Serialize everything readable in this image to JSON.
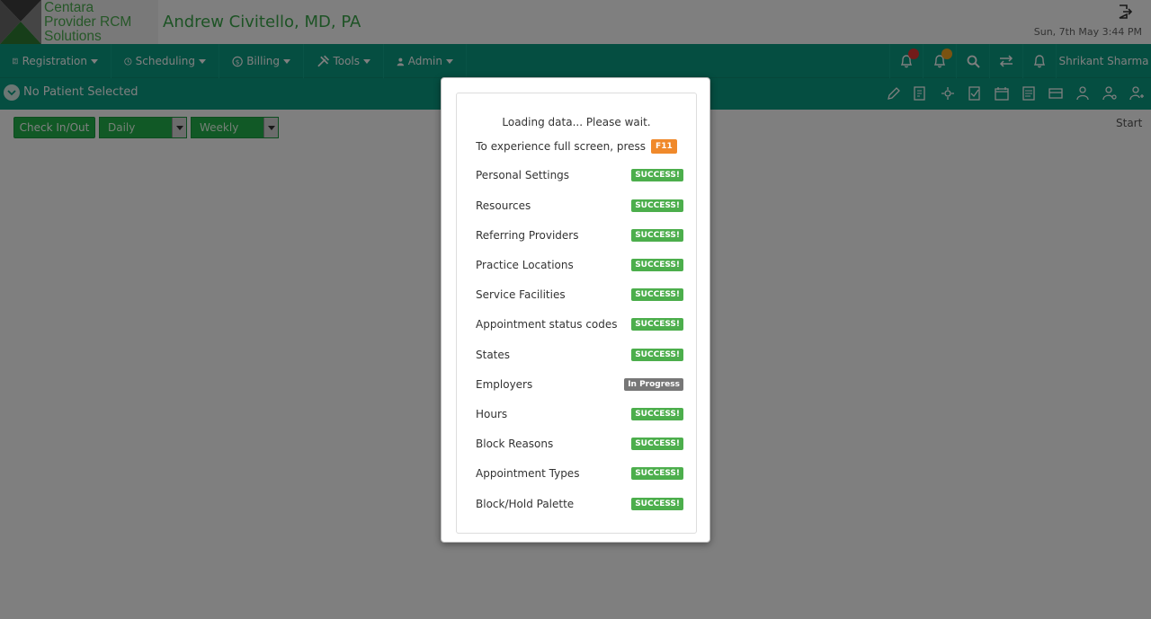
{
  "header": {
    "logo_lines": [
      "Centara",
      "Provider RCM",
      "Solutions"
    ],
    "provider_name": "Andrew Civitello, MD, PA",
    "datetime": "Sun, 7th May 3:44 PM"
  },
  "nav": {
    "items": [
      {
        "label": "Registration",
        "icon": "registration-icon"
      },
      {
        "label": "Scheduling",
        "icon": "clock-icon"
      },
      {
        "label": "Billing",
        "icon": "dollar-icon"
      },
      {
        "label": "Tools",
        "icon": "tools-icon"
      },
      {
        "label": "Admin",
        "icon": "user-icon"
      }
    ],
    "user_name": "Shrikant Sharma",
    "right_icons": [
      "bell-icon",
      "bell-icon",
      "search-icon",
      "switch-icon",
      "bell-icon"
    ]
  },
  "patient_bar": {
    "label": "No Patient Selected"
  },
  "toolbar": {
    "check_in_label": "Check In/Out",
    "view_select_1": "Daily",
    "view_select_2": "Weekly",
    "start_label": "Start"
  },
  "modal": {
    "loading_text": "Loading data... Please wait.",
    "fullscreen_text": "To experience full screen, press",
    "fullscreen_key": "F11",
    "rows": [
      {
        "label": "Personal Settings",
        "status": "SUCCESS!"
      },
      {
        "label": "Resources",
        "status": "SUCCESS!"
      },
      {
        "label": "Referring Providers",
        "status": "SUCCESS!"
      },
      {
        "label": "Practice Locations",
        "status": "SUCCESS!"
      },
      {
        "label": "Service Facilities",
        "status": "SUCCESS!"
      },
      {
        "label": "Appointment status codes",
        "status": "SUCCESS!"
      },
      {
        "label": "States",
        "status": "SUCCESS!"
      },
      {
        "label": "Employers",
        "status": "In Progress"
      },
      {
        "label": "Hours",
        "status": "SUCCESS!"
      },
      {
        "label": "Block Reasons",
        "status": "SUCCESS!"
      },
      {
        "label": "Appointment Types",
        "status": "SUCCESS!"
      },
      {
        "label": "Block/Hold Palette",
        "status": "SUCCESS!"
      }
    ]
  },
  "colors": {
    "nav_bg": "#0a9c82",
    "brand_green": "#3aa64a",
    "success": "#4cae4c",
    "in_progress": "#777777",
    "f11_key": "#f0892b",
    "notification_red": "#e53935",
    "notification_orange": "#f5a623"
  }
}
